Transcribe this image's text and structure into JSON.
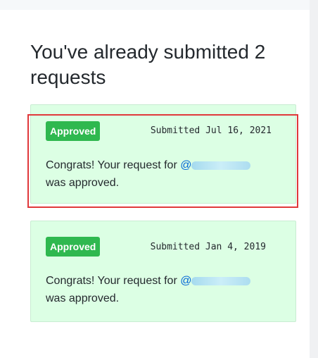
{
  "heading": "You've already submitted 2 requests",
  "requests": [
    {
      "status": "Approved",
      "submitted": "Submitted Jul 16, 2021",
      "message_prefix": "Congrats! Your request for",
      "mention_at": "@",
      "message_suffix": "was approved."
    },
    {
      "status": "Approved",
      "submitted": "Submitted Jan 4, 2019",
      "message_prefix": "Congrats! Your request for",
      "mention_at": "@",
      "message_suffix": "was approved."
    }
  ],
  "colors": {
    "card_background": "#dcffe4",
    "badge_background": "#2fb84f",
    "link": "#0366d6",
    "highlight_border": "#e0383a"
  }
}
